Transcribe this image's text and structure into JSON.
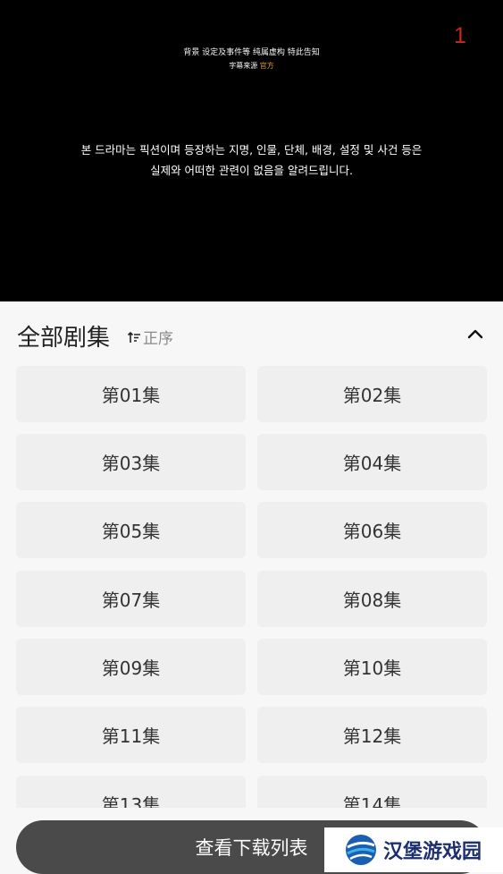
{
  "video": {
    "notice_line1": "背景 设定及事件等 纯属虚构 特此告知",
    "notice_line2_prefix": "字幕来源",
    "notice_line2_accent": "官方",
    "korean_line1": "본 드라마는 픽션이며 등장하는 지명, 인물, 단체, 배경, 설정 및 사건 등은",
    "korean_line2": "실제와 어떠한 관련이 없음을 알려드립니다.",
    "episode_marker": "1",
    "accent_color": "#e6a23c",
    "marker_color": "#c62828"
  },
  "panel": {
    "title": "全部剧集",
    "sort_label": "正序",
    "sort_icon": "sort-ascending-icon",
    "collapse_icon": "chevron-up-icon"
  },
  "episodes": [
    "第01集",
    "第02集",
    "第03集",
    "第04集",
    "第05集",
    "第06集",
    "第07集",
    "第08集",
    "第09集",
    "第10集",
    "第11集",
    "第12集",
    "第13集",
    "第14集"
  ],
  "bottom": {
    "download_list_label": "查看下载列表"
  },
  "watermark": {
    "text": "汉堡游戏园",
    "icon": "globe-logo-icon"
  }
}
